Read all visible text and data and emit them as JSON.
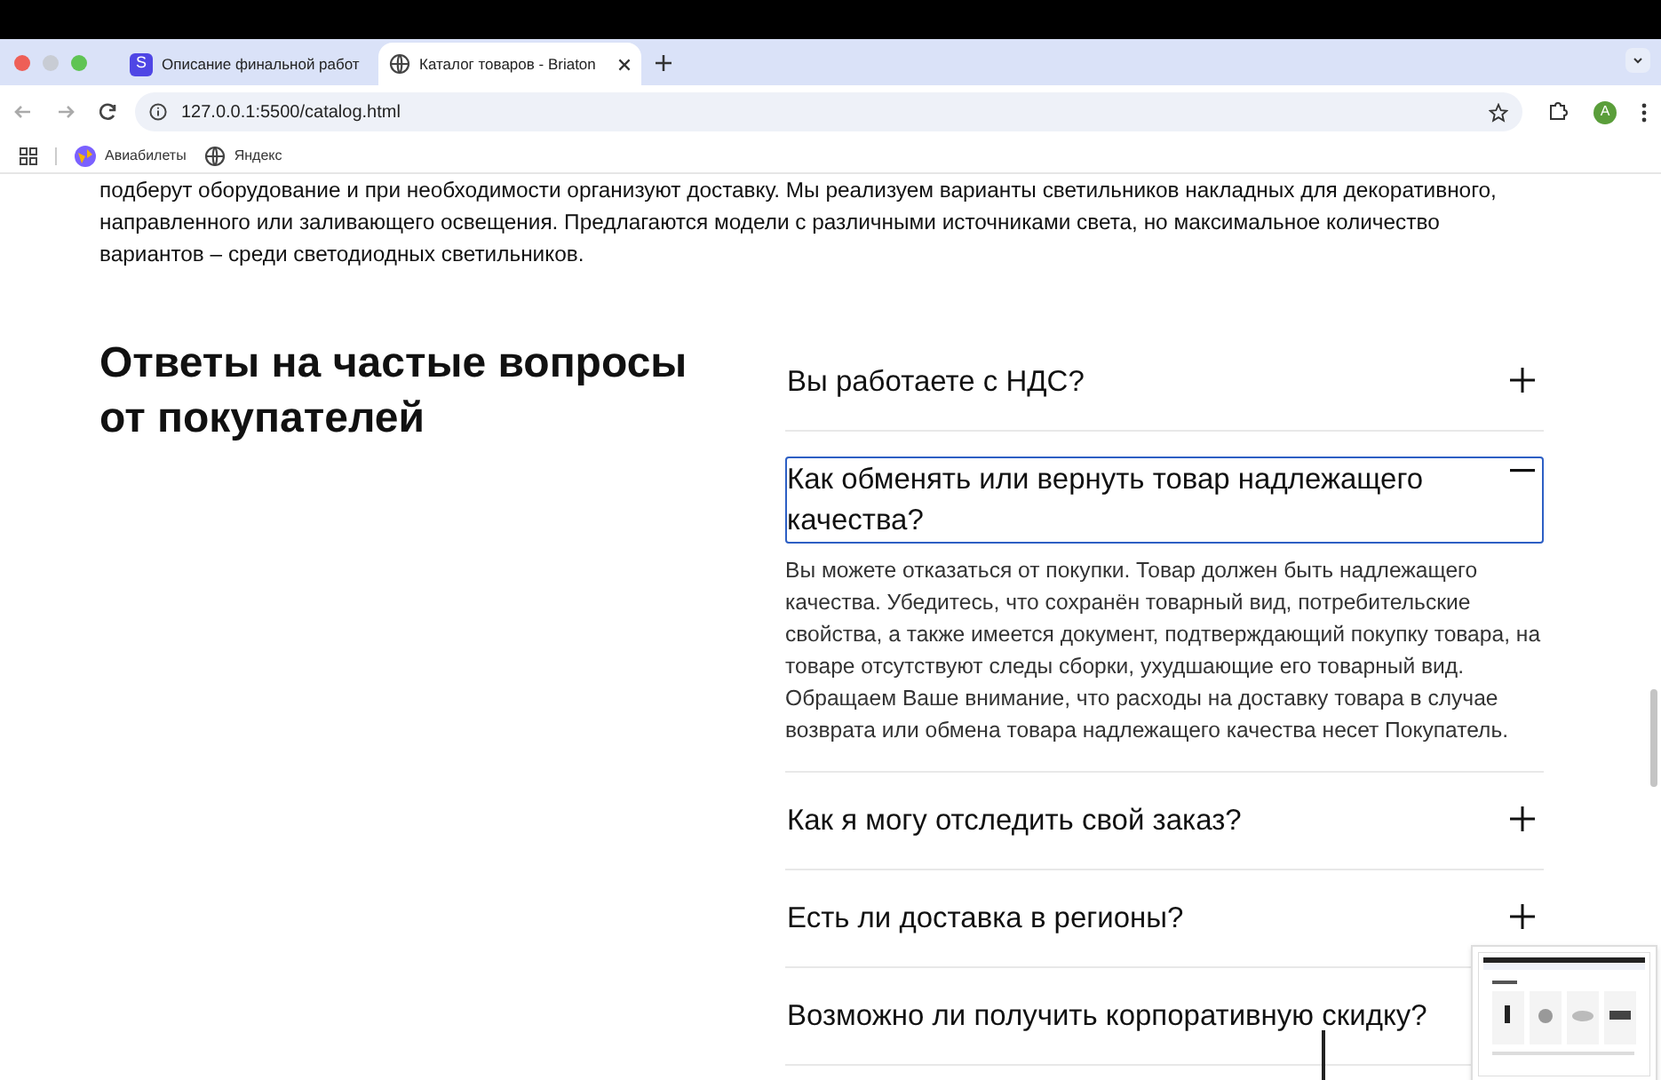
{
  "browser": {
    "tabs": [
      {
        "title": "Описание финальной работ",
        "selected": false,
        "favicon_text": "S"
      },
      {
        "title": "Каталог товаров - Briaton",
        "selected": true
      }
    ],
    "address": "127.0.0.1:5500/catalog.html",
    "profile": "A",
    "bookmarks": [
      {
        "label": "Авиабилеты"
      },
      {
        "label": "Яндекс"
      }
    ]
  },
  "page": {
    "intro": "подберут оборудование и при необходимости организуют доставку. Мы реализуем варианты светильников накладных для декоративного, направленного или заливающего освещения. Предлагаются модели с различными источниками света, но максимальное количество вариантов – среди светодиодных светильников.",
    "faq_title": "Ответы на частые вопросы от покупателей",
    "faq": [
      {
        "question": "Вы работаете с НДС?",
        "expanded": false,
        "focused": false
      },
      {
        "question": "Как обменять или вернуть товар надлежащего качества?",
        "expanded": true,
        "focused": true,
        "answer": "Вы можете отказаться от покупки. Товар должен быть надлежащего качества. Убедитесь, что сохранён товарный вид, потребительские свойства, а также имеется документ, подтверждающий покупку товара, на товаре отсутствуют следы сборки, ухудшающие его товарный вид. Обращаем Ваше внимание, что расходы на доставку товара в случае возврата или обмена товара надлежащего качества несет Покупатель."
      },
      {
        "question": "Как я могу отследить свой заказ?",
        "expanded": false,
        "focused": false
      },
      {
        "question": "Есть ли доставка в регионы?",
        "expanded": false,
        "focused": false
      },
      {
        "question": "Возможно ли получить корпоративную скидку?",
        "expanded": false,
        "focused": false
      }
    ]
  }
}
